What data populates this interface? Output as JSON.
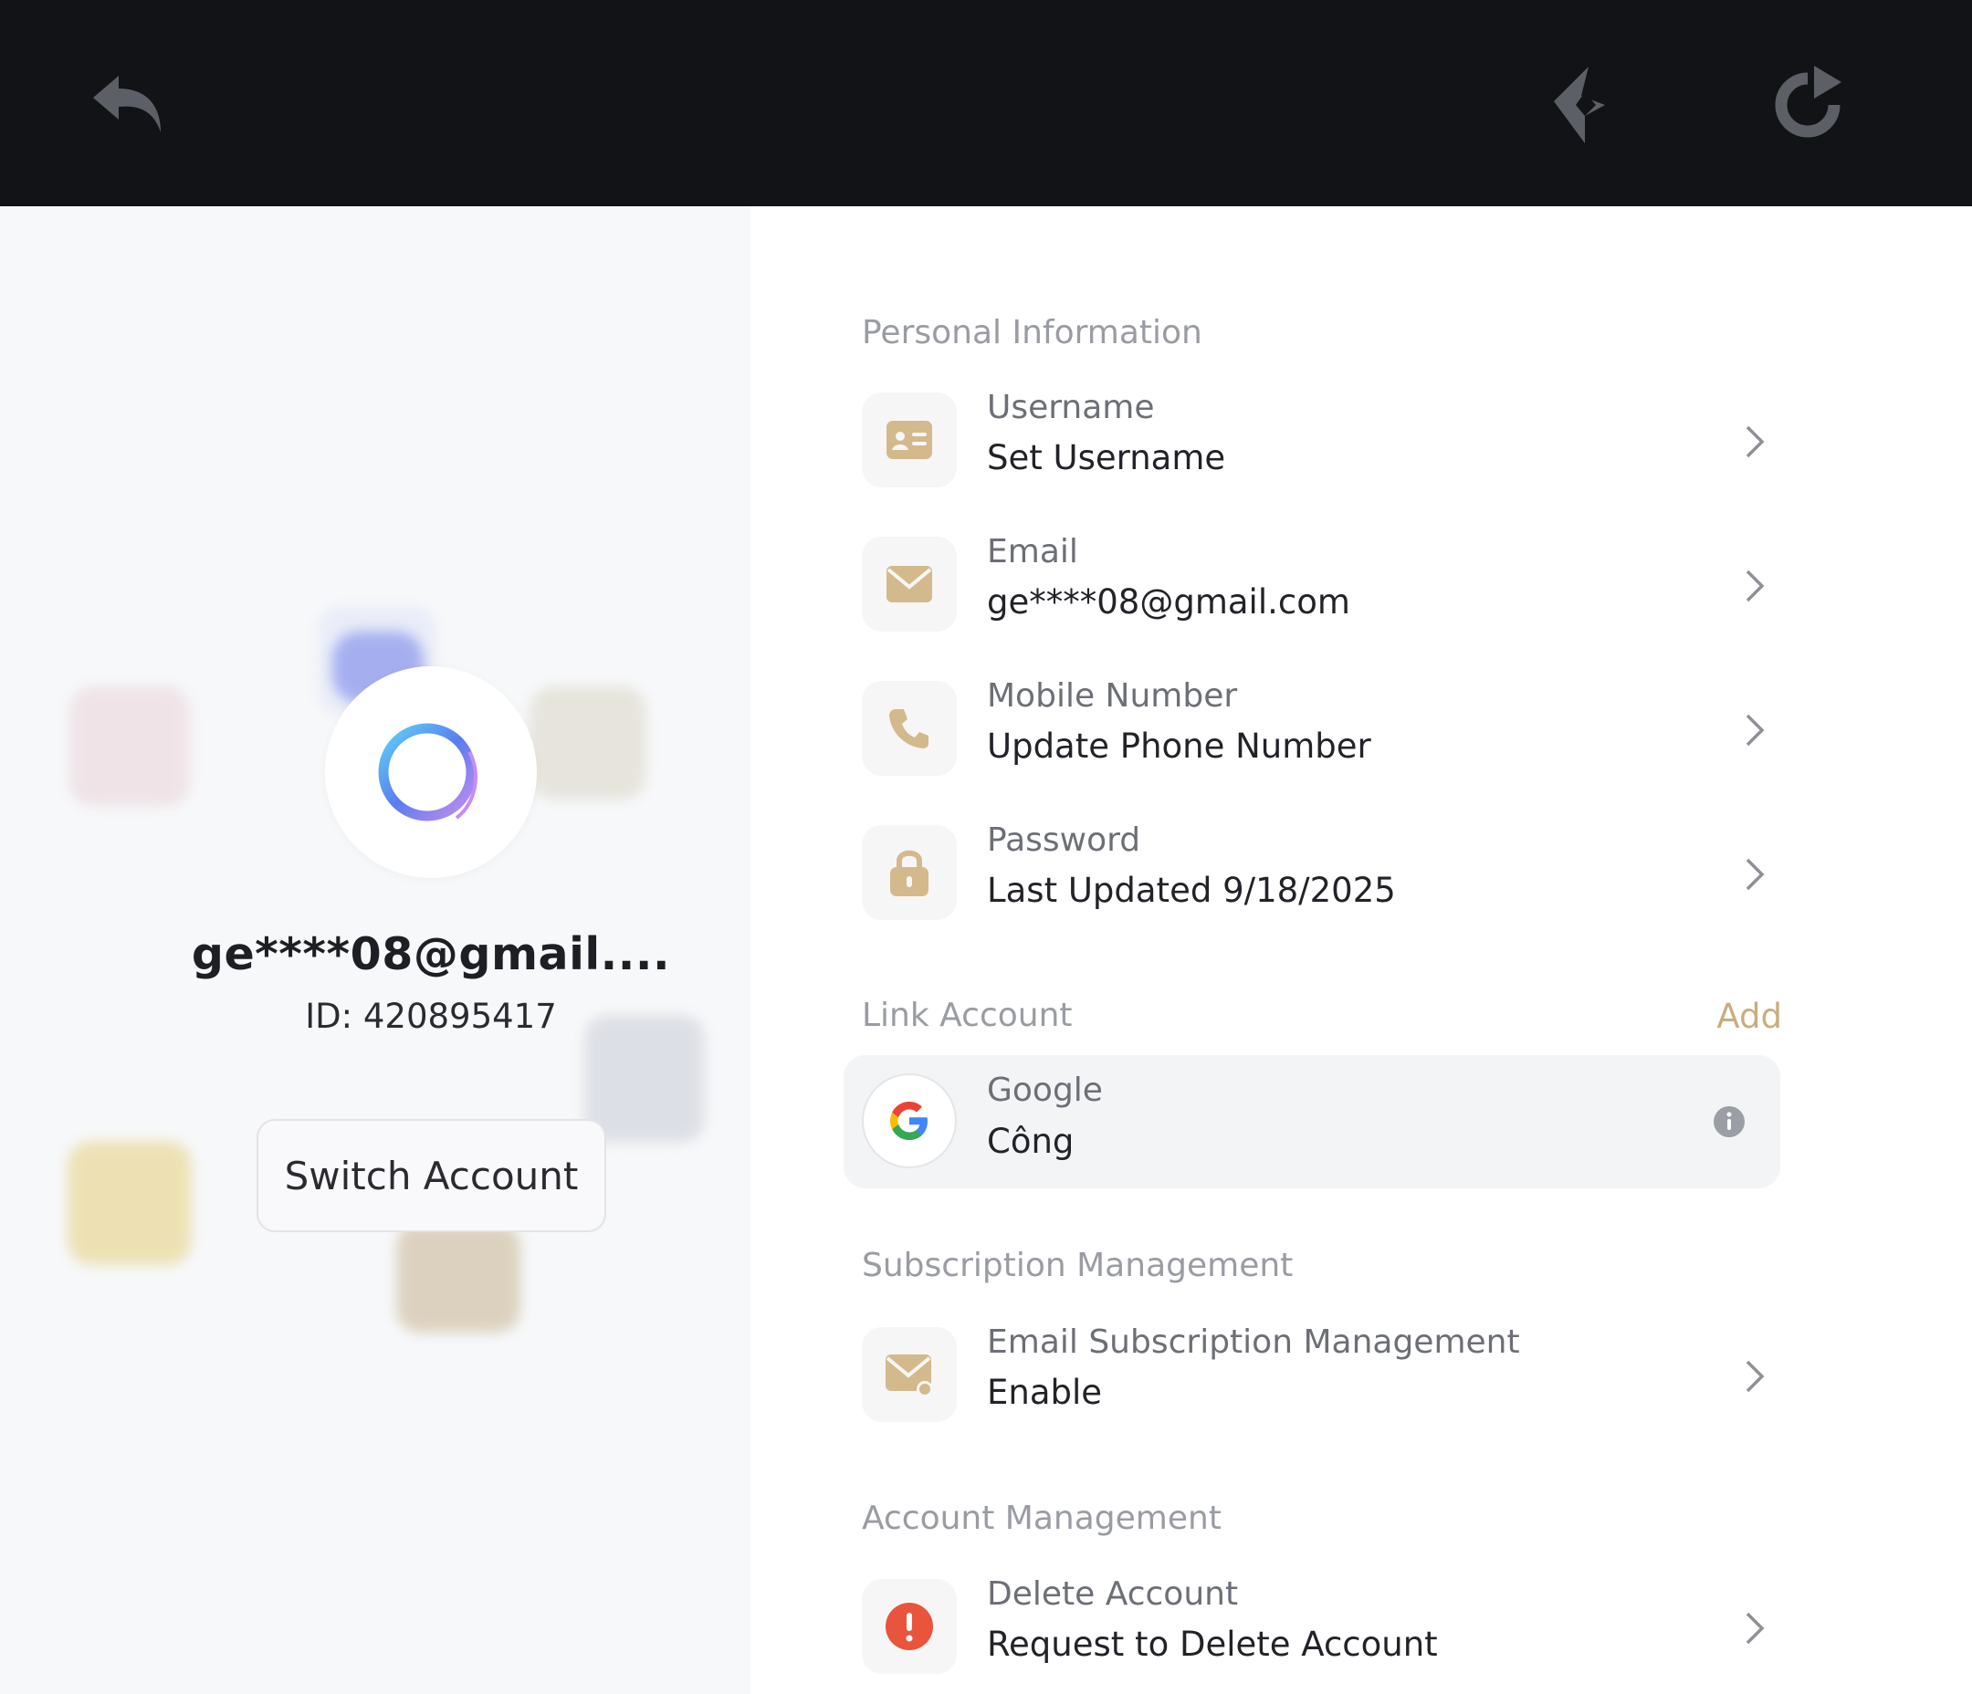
{
  "topbar": {
    "back_icon": "back-arrow-icon",
    "brand_icon": "brand-logo-icon",
    "refresh_icon": "refresh-icon"
  },
  "profile": {
    "name": "ge****08@gmail....",
    "id_text": "ID: 420895417",
    "switch_label": "Switch Account"
  },
  "sections": {
    "personal": "Personal Information",
    "link": "Link Account",
    "link_add": "Add",
    "subscription": "Subscription Management",
    "account": "Account Management"
  },
  "personal_rows": [
    {
      "label": "Username",
      "value": "Set Username",
      "icon": "id-card-icon"
    },
    {
      "label": "Email",
      "value": "ge****08@gmail.com",
      "icon": "envelope-icon"
    },
    {
      "label": "Mobile Number",
      "value": "Update Phone Number",
      "icon": "phone-icon"
    },
    {
      "label": "Password",
      "value": "Last Updated 9/18/2025",
      "icon": "lock-icon"
    }
  ],
  "linked": {
    "label": "Google",
    "value": "Công",
    "icon": "google-icon"
  },
  "subscription_row": {
    "label": "Email Subscription Management",
    "value": "Enable",
    "icon": "mail-subscription-icon"
  },
  "account_row": {
    "label": "Delete Account",
    "value": "Request to Delete Account",
    "icon": "alert-icon"
  },
  "colors": {
    "topbar": "#121316",
    "accent_gold": "#c9ae7d",
    "icon_gold": "#d3b98b",
    "danger": "#e8543c"
  }
}
